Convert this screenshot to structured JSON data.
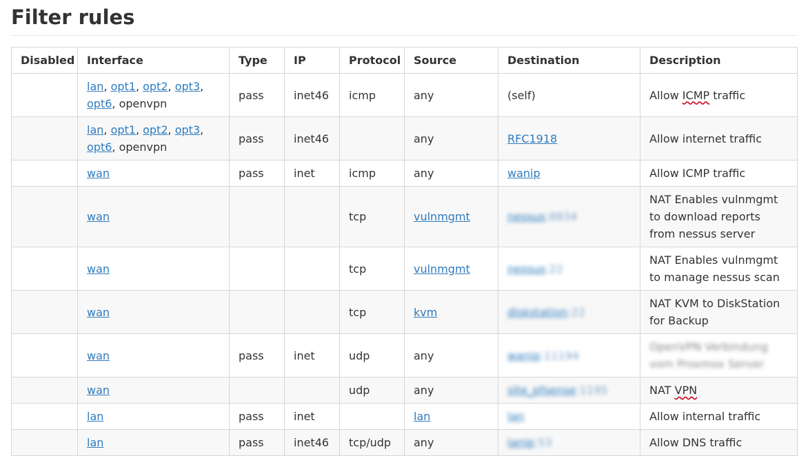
{
  "page": {
    "title": "Filter rules"
  },
  "table": {
    "headers": [
      "Disabled",
      "Interface",
      "Type",
      "IP",
      "Protocol",
      "Source",
      "Destination",
      "Description"
    ],
    "rows": [
      {
        "disabled": "",
        "interface": [
          {
            "text": "lan",
            "link": true
          },
          {
            "text": ", "
          },
          {
            "text": "opt1",
            "link": true
          },
          {
            "text": ", "
          },
          {
            "text": "opt2",
            "link": true
          },
          {
            "text": ", "
          },
          {
            "text": "opt3",
            "link": true
          },
          {
            "text": ","
          },
          {
            "br": true
          },
          {
            "text": "opt6",
            "link": true
          },
          {
            "text": ", openvpn"
          }
        ],
        "type": "pass",
        "ip": "inet46",
        "protocol": "icmp",
        "source": [
          {
            "text": "any"
          }
        ],
        "destination": [
          {
            "text": "(self)"
          }
        ],
        "description": [
          {
            "text": "Allow "
          },
          {
            "text": "ICMP",
            "spell": true
          },
          {
            "text": " traffic"
          }
        ],
        "height": 63
      },
      {
        "disabled": "",
        "interface": [
          {
            "text": "lan",
            "link": true
          },
          {
            "text": ", "
          },
          {
            "text": "opt1",
            "link": true
          },
          {
            "text": ", "
          },
          {
            "text": "opt2",
            "link": true
          },
          {
            "text": ", "
          },
          {
            "text": "opt3",
            "link": true
          },
          {
            "text": ","
          },
          {
            "br": true
          },
          {
            "text": "opt6",
            "link": true
          },
          {
            "text": ", openvpn"
          }
        ],
        "type": "pass",
        "ip": "inet46",
        "protocol": "",
        "source": [
          {
            "text": "any"
          }
        ],
        "destination": [
          {
            "text": "RFC1918",
            "link": true
          }
        ],
        "description": [
          {
            "text": "Allow internet traffic"
          }
        ],
        "height": 63
      },
      {
        "disabled": "",
        "interface": [
          {
            "text": "wan",
            "link": true
          }
        ],
        "type": "pass",
        "ip": "inet",
        "protocol": "icmp",
        "source": [
          {
            "text": "any"
          }
        ],
        "destination": [
          {
            "text": "wanip",
            "link": true
          }
        ],
        "description": [
          {
            "text": "Allow ICMP traffic"
          }
        ],
        "height": 38
      },
      {
        "disabled": "",
        "interface": [
          {
            "text": "wan",
            "link": true
          }
        ],
        "type": "",
        "ip": "",
        "protocol": "tcp",
        "source": [
          {
            "text": "vulnmgmt",
            "link": true
          }
        ],
        "destination": [
          {
            "text": "nessus",
            "link": true,
            "blur": true
          },
          {
            "text": ":8834",
            "blur": true,
            "muted": true
          }
        ],
        "description": [
          {
            "text": "NAT Enables vulnmgmt to download reports from nessus server"
          }
        ],
        "height": 88
      },
      {
        "disabled": "",
        "interface": [
          {
            "text": "wan",
            "link": true
          }
        ],
        "type": "",
        "ip": "",
        "protocol": "tcp",
        "source": [
          {
            "text": "vulnmgmt",
            "link": true
          }
        ],
        "destination": [
          {
            "text": "nessus",
            "link": true,
            "blur": true
          },
          {
            "text": ":22",
            "blur": true,
            "muted": true
          }
        ],
        "description": [
          {
            "text": "NAT Enables vulnmgmt to manage nessus scan"
          }
        ],
        "height": 63
      },
      {
        "disabled": "",
        "interface": [
          {
            "text": "wan",
            "link": true
          }
        ],
        "type": "",
        "ip": "",
        "protocol": "tcp",
        "source": [
          {
            "text": "kvm",
            "link": true
          }
        ],
        "destination": [
          {
            "text": "diskstation",
            "link": true,
            "blur": true
          },
          {
            "text": ":22",
            "blur": true,
            "muted": true
          }
        ],
        "description": [
          {
            "text": "NAT KVM to DiskStation for Backup"
          }
        ],
        "height": 63
      },
      {
        "disabled": "",
        "interface": [
          {
            "text": "wan",
            "link": true
          }
        ],
        "type": "pass",
        "ip": "inet",
        "protocol": "udp",
        "source": [
          {
            "text": "any"
          }
        ],
        "destination": [
          {
            "text": "wanip",
            "link": true,
            "blur": true
          },
          {
            "text": ":11194",
            "blur": true,
            "muted": true
          }
        ],
        "description": [
          {
            "text": "OpenVPN Verbindung vom Proxmox Server",
            "blurtext": true
          }
        ],
        "height": 63
      },
      {
        "disabled": "",
        "interface": [
          {
            "text": "wan",
            "link": true
          }
        ],
        "type": "",
        "ip": "",
        "protocol": "udp",
        "source": [
          {
            "text": "any"
          }
        ],
        "destination": [
          {
            "text": "site_pfsense",
            "link": true,
            "blur": true
          },
          {
            "text": ":1195",
            "blur": true,
            "muted": true
          }
        ],
        "description": [
          {
            "text": "NAT "
          },
          {
            "text": "VPN",
            "spell": true
          }
        ],
        "height": 38
      },
      {
        "disabled": "",
        "interface": [
          {
            "text": "lan",
            "link": true
          }
        ],
        "type": "pass",
        "ip": "inet",
        "protocol": "",
        "source": [
          {
            "text": "lan",
            "link": true
          }
        ],
        "destination": [
          {
            "text": "lan",
            "link": true,
            "blur": true
          }
        ],
        "description": [
          {
            "text": "Allow internal traffic"
          }
        ],
        "height": 38
      },
      {
        "disabled": "",
        "interface": [
          {
            "text": "lan",
            "link": true
          }
        ],
        "type": "pass",
        "ip": "inet46",
        "protocol": "tcp/udp",
        "source": [
          {
            "text": "any"
          }
        ],
        "destination": [
          {
            "text": "lanip",
            "link": true,
            "blur": true
          },
          {
            "text": ":53",
            "blur": true,
            "muted": true
          }
        ],
        "description": [
          {
            "text": "Allow DNS traffic"
          }
        ],
        "height": 38
      }
    ]
  },
  "colors": {
    "link": "#2e7bbd",
    "border": "#d6d6d6",
    "row_alt": "#f8f8f8",
    "text": "#333333"
  }
}
